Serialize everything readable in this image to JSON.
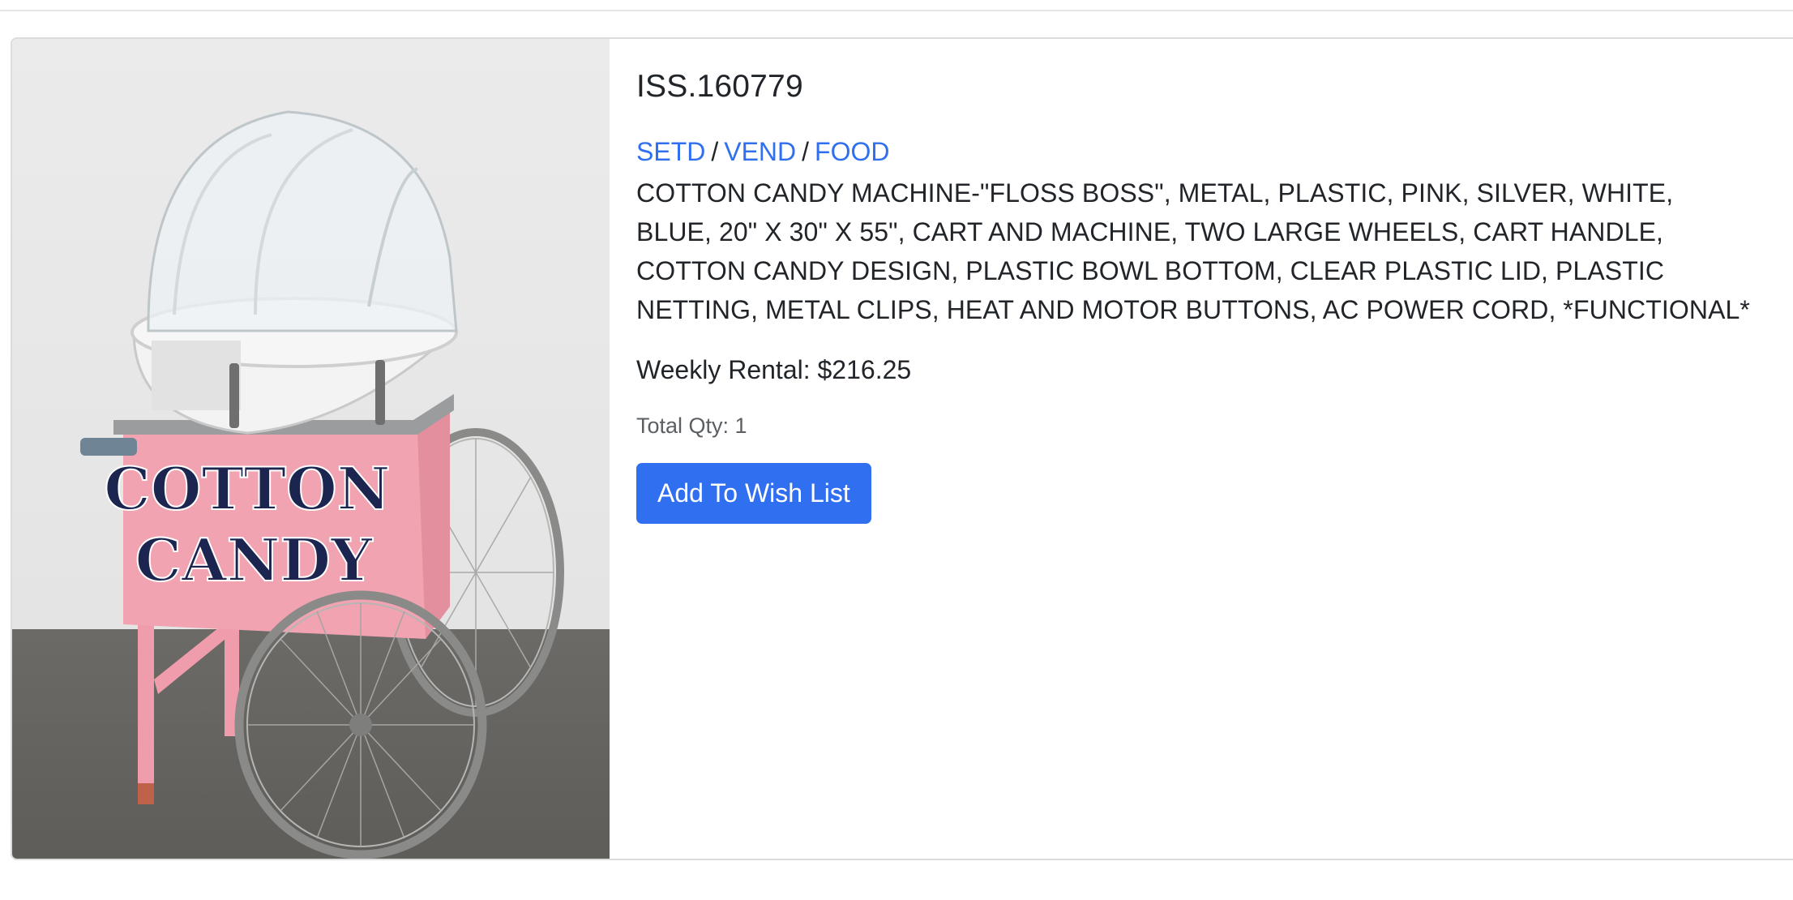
{
  "product": {
    "code": "ISS.160779",
    "image_alt": "Cotton candy machine cart",
    "cart_lettering": [
      "COTTON",
      "CANDY"
    ],
    "breadcrumb": [
      {
        "label": "SETD"
      },
      {
        "label": "VEND"
      },
      {
        "label": "FOOD"
      }
    ],
    "breadcrumb_separator": "/",
    "description": "COTTON CANDY MACHINE-\"FLOSS BOSS\", METAL, PLASTIC, PINK, SILVER, WHITE, BLUE, 20\" X 30\" X 55\", CART AND MACHINE, TWO LARGE WHEELS, CART HANDLE, COTTON CANDY DESIGN, PLASTIC BOWL BOTTOM, CLEAR PLASTIC LID, PLASTIC NETTING, METAL CLIPS, HEAT AND MOTOR BUTTONS, AC POWER CORD, *FUNCTIONAL*",
    "weekly_rental": "Weekly Rental: $216.25",
    "total_qty": "Total Qty: 1",
    "wish_button_label": "Add To Wish List"
  },
  "colors": {
    "link": "#2f6ff0",
    "button": "#2f6ff0",
    "cart_pink": "#f2a3b1",
    "lettering_navy": "#1c2450"
  }
}
